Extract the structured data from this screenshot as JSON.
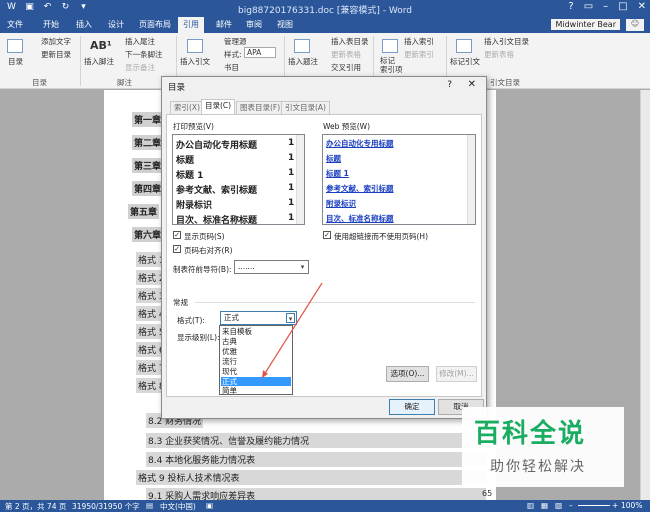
{
  "window": {
    "title": "big88720176331.doc [兼容模式] - Word",
    "user": "Midwinter Bear",
    "user_icon": "smiley-icon"
  },
  "ribbon_tabs": [
    "文件",
    "开始",
    "插入",
    "设计",
    "页面布局",
    "引用",
    "邮件",
    "审阅",
    "视图"
  ],
  "ribbon_active_tab": "引用",
  "ribbon": {
    "toc_btn": "目录",
    "add_text": "添加文字",
    "update_toc": "更新目录",
    "group_toc": "目录",
    "insert_footnote": "插入脚注",
    "insert_endnote": "插入尾注",
    "next_footnote": "下一条脚注",
    "show_notes": "显示备注",
    "group_footnotes": "脚注",
    "insert_citation": "插入引文",
    "manage_sources": "管理源",
    "style_label": "样式:",
    "style_value": "APA",
    "bibliography": "书目",
    "insert_caption": "插入题注",
    "insert_table_of_figures": "插入表目录",
    "update_table": "更新表格",
    "cross_reference": "交叉引用",
    "mark_entry": "标记\n索引项",
    "insert_index": "插入索引",
    "update_index": "更新索引",
    "mark_citation": "标记引文",
    "insert_toa": "插入引文目录",
    "update_toa": "更新表格",
    "group_toa": "引文目录"
  },
  "document": {
    "headings1": [
      "第一章",
      "第二章",
      "第三章",
      "第四章",
      "第五章",
      "第六章"
    ],
    "headings2": [
      "格式 1",
      "格式 2",
      "格式 3",
      "格式 4",
      "格式 5",
      "格式 6",
      "格式 7",
      "格式 8"
    ],
    "lines": [
      {
        "text": "8.2 财务情况",
        "page": ""
      },
      {
        "text": "8.3 企业获奖情况、信誉及履约能力情况",
        "page": ""
      },
      {
        "text": "8.4 本地化服务能力情况表",
        "page": ""
      },
      {
        "text": "格式 9 投标人技术情况表",
        "page": ""
      },
      {
        "text": "9.1 采购人需求响应差异表",
        "page": "65"
      }
    ]
  },
  "dialog": {
    "title": "目录",
    "help": "?",
    "close": "✕",
    "tabs": [
      "索引(X)",
      "目录(C)",
      "图表目录(F)",
      "引文目录(A)"
    ],
    "active_tab": "目录(C)",
    "print_preview_label": "打印预览(V)",
    "print_preview_lines": [
      {
        "text": "办公自动化专用标题",
        "page": "1"
      },
      {
        "text": "标题",
        "page": "1"
      },
      {
        "text": "标题 1",
        "page": "1"
      },
      {
        "text": "参考文献、索引标题",
        "page": "1"
      },
      {
        "text": "附录标识",
        "page": "1"
      },
      {
        "text": "目次、标准名称标题",
        "page": "1"
      }
    ],
    "web_preview_label": "Web 预览(W)",
    "web_preview_lines": [
      "办公自动化专用标题",
      "标题",
      "标题 1",
      "参考文献、索引标题",
      "附录标识",
      "目次、标准名称标题"
    ],
    "show_page_numbers": "显示页码(S)",
    "align_right": "页码右对齐(R)",
    "use_hyperlinks": "使用超链接而不使用页码(H)",
    "tab_leader_label": "制表符前导符(B):",
    "tab_leader_value": ".......",
    "general_label": "常规",
    "formats_label": "格式(T):",
    "formats_value": "正式",
    "show_levels_label": "显示级别(L):",
    "format_options": [
      "来自模板",
      "古典",
      "优雅",
      "流行",
      "现代",
      "正式",
      "简单"
    ],
    "format_selected": "正式",
    "options_btn": "选项(O)...",
    "modify_btn": "修改(M)...",
    "ok_btn": "确定",
    "cancel_btn": "取消"
  },
  "status": {
    "page": "第 2 页，共 74 页",
    "words": "31950/31950 个字",
    "language": "中文(中国)",
    "zoom": "100%"
  },
  "watermark": {
    "title": "百科全说",
    "subtitle": "助你轻松解决"
  },
  "colors": {
    "word_blue": "#2b579a",
    "selection_blue": "#3399ff",
    "annotation_red": "#e0584a",
    "watermark_green": "#1aad62"
  }
}
